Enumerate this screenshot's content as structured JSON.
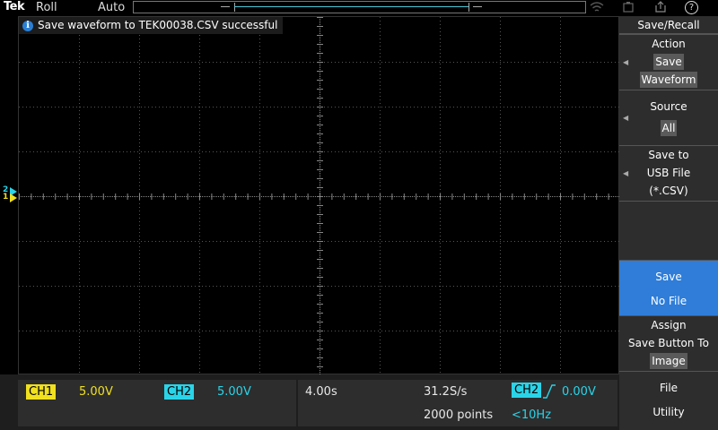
{
  "topbar": {
    "brand": "Tek",
    "acq_mode": "Roll",
    "trigger_mode": "Auto",
    "help": "?"
  },
  "notice": {
    "message": "Save waveform to TEK00038.CSV successful",
    "icon": "i"
  },
  "markers": {
    "ch2": "2",
    "ch1": "1"
  },
  "menu": {
    "title": "Save/Recall",
    "action": {
      "label": "Action",
      "line1": "Save",
      "line2": "Waveform"
    },
    "source": {
      "label": "Source",
      "value": "All"
    },
    "save_to": {
      "line1": "Save to",
      "line2": "USB File",
      "line3": "(*.CSV)"
    },
    "save": {
      "line1": "Save",
      "line2": "No File"
    },
    "assign": {
      "line1": "Assign",
      "line2": "Save Button To",
      "value": "Image"
    },
    "file_utility": {
      "line1": "File",
      "line2": "Utility"
    }
  },
  "readout": {
    "ch1_label": "CH1",
    "ch1_scale": "5.00V",
    "ch2_label": "CH2",
    "ch2_scale": "5.00V",
    "timebase": "4.00s",
    "sample_rate": "31.2S/s",
    "record_length": "2000 points",
    "trigger_source": "CH2",
    "trigger_level": "0.00V",
    "trigger_freq": "<10Hz"
  },
  "colors": {
    "ch1": "#f0e020",
    "ch2": "#2ad4e8",
    "accent": "#2f7dd8"
  }
}
